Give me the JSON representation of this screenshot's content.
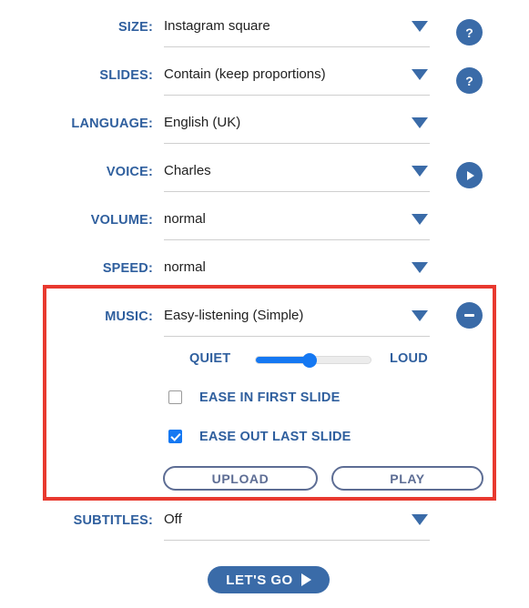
{
  "rows": [
    {
      "label": "SIZE:",
      "value": "Instagram square",
      "help": "?"
    },
    {
      "label": "SLIDES:",
      "value": "Contain (keep proportions)",
      "help": "?"
    },
    {
      "label": "LANGUAGE:",
      "value": "English (UK)"
    },
    {
      "label": "VOICE:",
      "value": "Charles"
    },
    {
      "label": "VOLUME:",
      "value": "normal"
    },
    {
      "label": "SPEED:",
      "value": "normal"
    },
    {
      "label": "MUSIC:",
      "value": "Easy-listening (Simple)"
    },
    {
      "label": "SUBTITLES:",
      "value": "Off"
    }
  ],
  "music_panel": {
    "slider": {
      "min_label": "QUIET",
      "max_label": "LOUD",
      "value_percent": 47
    },
    "checkboxes": [
      {
        "label": "EASE IN FIRST SLIDE",
        "checked": false
      },
      {
        "label": "EASE OUT LAST SLIDE",
        "checked": true
      }
    ],
    "buttons": {
      "upload": "UPLOAD",
      "play": "PLAY"
    },
    "collapse_button": "minus-icon"
  },
  "icons": {
    "help": "?",
    "voice_preview": "play-icon",
    "music_collapse": "minus-icon",
    "dropdown": "chevron-down-icon"
  },
  "cta": {
    "label": "LET'S GO"
  },
  "colors": {
    "label_blue": "#2f5f9e",
    "accent_blue": "#3a6ba8",
    "slider_blue": "#1578f2",
    "highlight_red": "#e8392f",
    "pill_border": "#5d6d94"
  }
}
